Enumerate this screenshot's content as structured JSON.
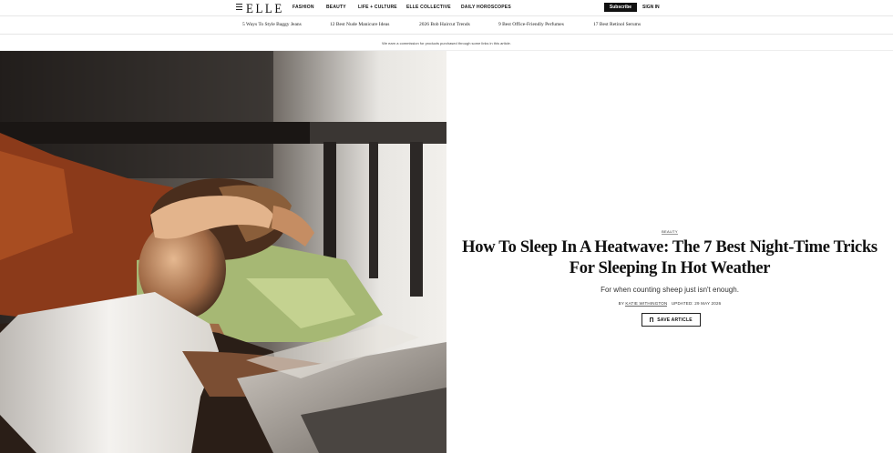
{
  "header": {
    "logo": "ELLE",
    "nav": [
      "FASHION",
      "BEAUTY",
      "LIFE + CULTURE",
      "ELLE COLLECTIVE",
      "DAILY HOROSCOPES"
    ],
    "subscribe_label": "Subscribe",
    "signin_label": "SIGN IN"
  },
  "trending": [
    "5 Ways To Style Baggy Jeans",
    "12 Best Nude Manicure Ideas",
    "2026 Bob Haircut Trends",
    "9 Best Office-Friendly Perfumes",
    "17 Best Retinol Serums"
  ],
  "disclaimer": "We earn a commission for products purchased through some links in this article.",
  "article": {
    "category": "BEAUTY",
    "headline_line1": "How To Sleep In A Heatwave: The 7 Best Night-Time Tricks",
    "headline_line2": "For Sleeping In Hot Weather",
    "dek": "For when counting sheep just isn't enough.",
    "by_prefix": "BY",
    "author": "KATIE WITHINGTON",
    "updated": "UPDATED: 29 MAY 2026",
    "save_label": "SAVE ARTICLE"
  }
}
